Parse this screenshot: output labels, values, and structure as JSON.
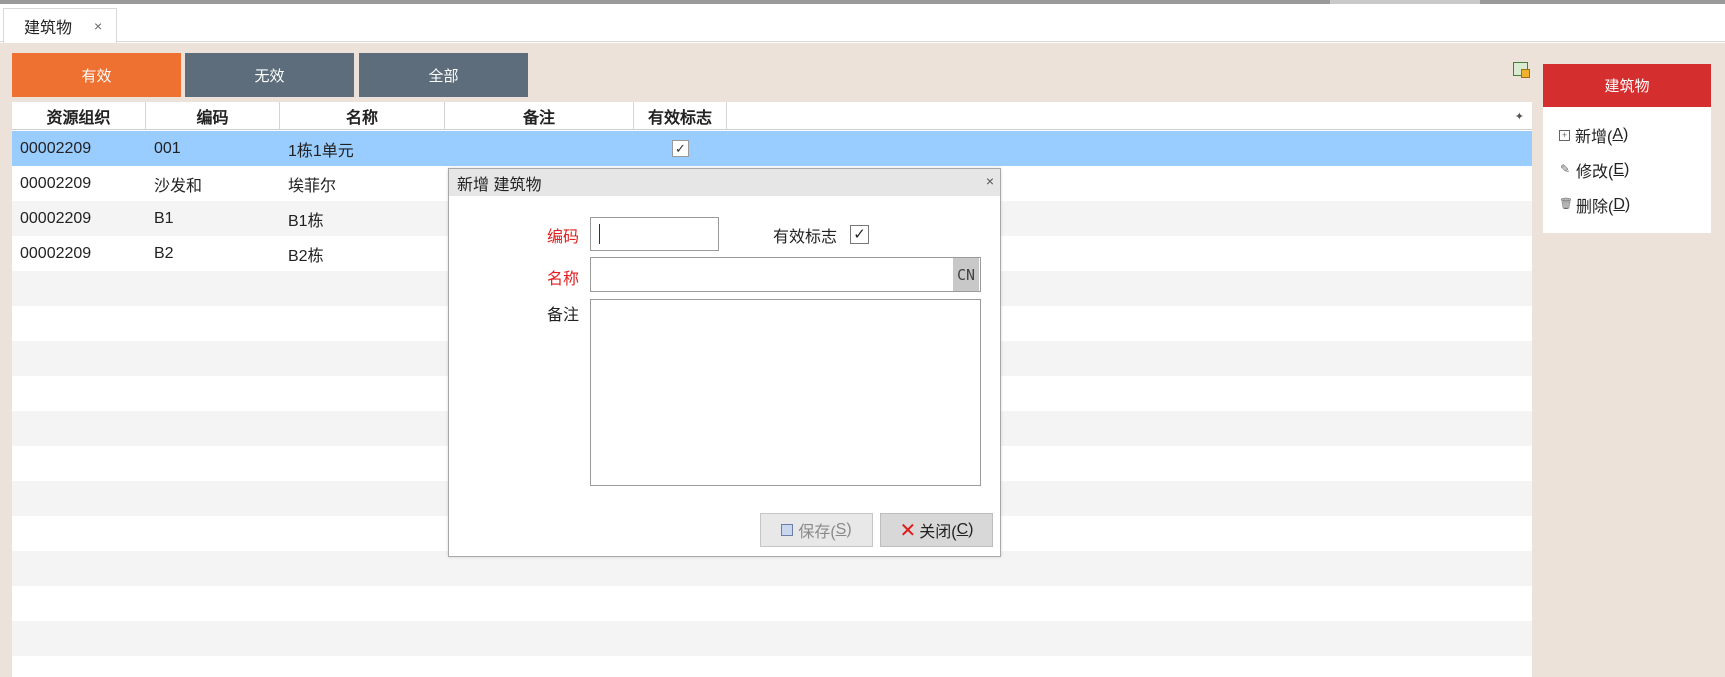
{
  "tab": {
    "label": "建筑物",
    "close": "×"
  },
  "filters": {
    "valid": "有效",
    "invalid": "无效",
    "all": "全部"
  },
  "colors": {
    "accent": "#ef7132",
    "filter_inactive": "#5d6d7b",
    "panel_header": "#d42e2e",
    "selected_row": "#99ccff",
    "required_label": "#e02020"
  },
  "grid": {
    "columns": [
      "资源组织",
      "编码",
      "名称",
      "备注",
      "有效标志"
    ],
    "settings_glyph": "✦",
    "rows": [
      {
        "org": "00002209",
        "code": "001",
        "name": "1栋1单元",
        "note": "",
        "valid": "✓"
      },
      {
        "org": "00002209",
        "code": "沙发和",
        "name": "埃菲尔",
        "note": "",
        "valid": ""
      },
      {
        "org": "00002209",
        "code": "B1",
        "name": "B1栋",
        "note": "",
        "valid": ""
      },
      {
        "org": "00002209",
        "code": "B2",
        "name": "B2栋",
        "note": "",
        "valid": ""
      }
    ]
  },
  "side_panel": {
    "title": "建筑物",
    "add": {
      "text": "新增(",
      "key": "A",
      "end": ")"
    },
    "edit": {
      "text": "修改(",
      "key": "E",
      "end": ")"
    },
    "delete": {
      "text": "删除(",
      "key": "D",
      "end": ")"
    }
  },
  "dialog": {
    "title": "新增 建筑物",
    "close": "×",
    "code_label": "编码",
    "code_value": "",
    "valid_label": "有效标志",
    "valid_check": "✓",
    "name_label": "名称",
    "name_value": "",
    "lang_badge": "CN",
    "note_label": "备注",
    "note_value": "",
    "save": {
      "text": "保存(",
      "key": "S",
      "end": ")"
    },
    "close_btn": {
      "text": "关闭(",
      "key": "C",
      "end": ")"
    }
  }
}
